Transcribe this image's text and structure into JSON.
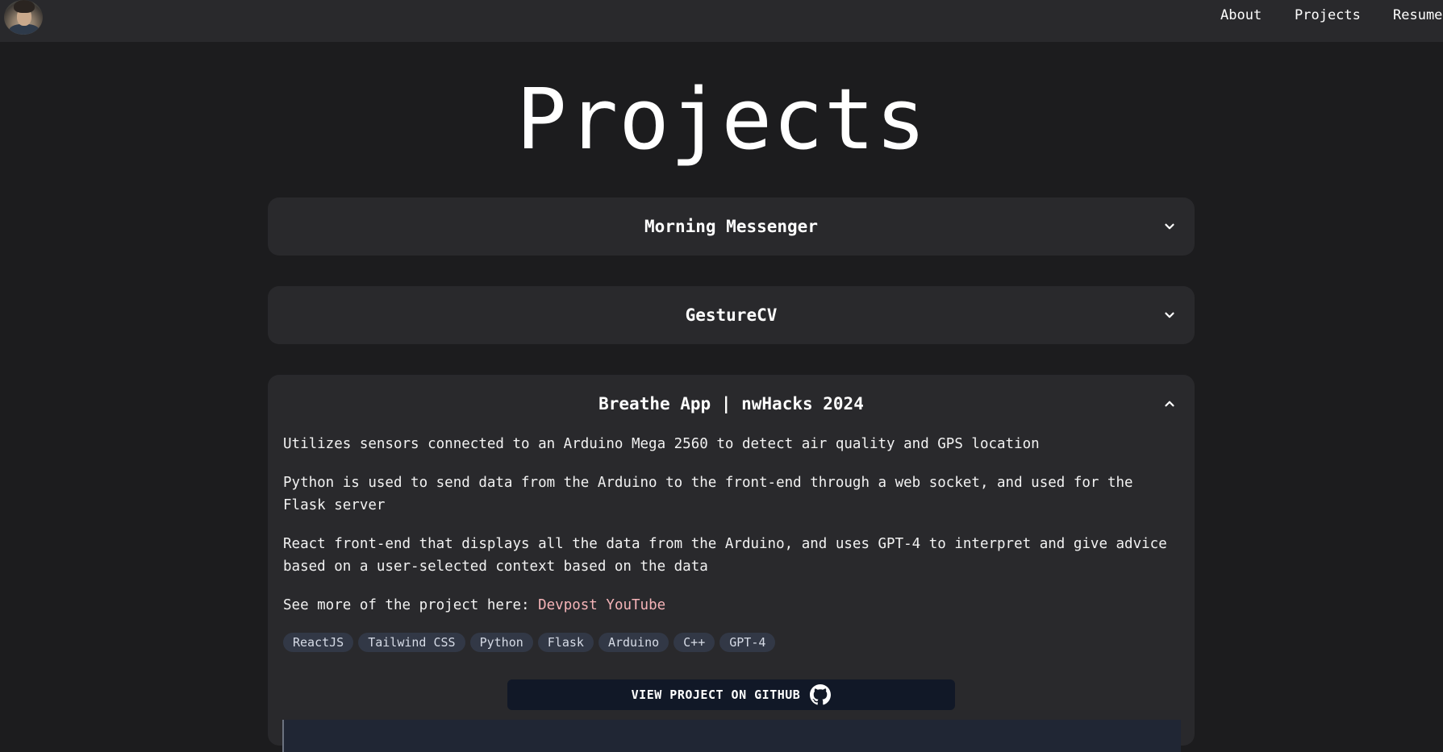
{
  "nav": {
    "about": "About",
    "projects": "Projects",
    "resume": "Resume"
  },
  "page": {
    "title": "Projects"
  },
  "projects": [
    {
      "title": "Morning Messenger",
      "expanded": false
    },
    {
      "title": "GestureCV",
      "expanded": false
    },
    {
      "title": "Breathe App | nwHacks 2024",
      "expanded": true,
      "paragraphs": [
        "Utilizes sensors connected to an Arduino Mega 2560 to detect air quality and GPS location",
        "Python is used to send data from the Arduino to the front-end through a web socket, and used for the Flask server",
        "React front-end that displays all the data from the Arduino, and uses GPT-4 to interpret and give advice based on a user-selected context based on the data"
      ],
      "see_more_label": "See more of the project here:",
      "links": [
        "Devpost",
        "YouTube"
      ],
      "tags": [
        "ReactJS",
        "Tailwind CSS",
        "Python",
        "Flask",
        "Arduino",
        "C++",
        "GPT-4"
      ],
      "github_button": "VIEW PROJECT ON GITHUB"
    }
  ],
  "icons": {
    "collapsed": "chevron-down-icon",
    "expanded": "chevron-up-icon",
    "github": "github-icon"
  },
  "colors": {
    "background": "#1c1c1e",
    "card": "#29292c",
    "link": "#f5b4b8",
    "tag_bg": "#323846",
    "button_bg": "#111827"
  }
}
